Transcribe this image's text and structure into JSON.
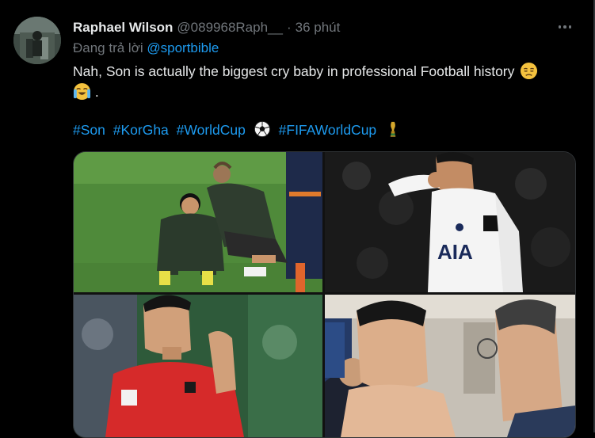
{
  "tweet": {
    "author_name": "Raphael Wilson",
    "author_handle": "@089968Raph__",
    "separator": "·",
    "time": "36 phút",
    "replying_prefix": "Đang trả lời",
    "replying_to": "@sportbible",
    "text": "Nah, Son is actually the biggest cry baby in professional Football history",
    "text_suffix": ".",
    "emojis": [
      "disappointed-face-emoji",
      "crying-face-emoji"
    ],
    "hashtags": [
      "#Son",
      "#KorGha",
      "#WorldCup",
      "#FIFAWorldCup"
    ],
    "hashtag_icons": [
      "soccer-ball-icon",
      "trophy-icon"
    ]
  },
  "media": {
    "photos": [
      "players-sitting-on-pitch",
      "player-wiping-eye-white-kit",
      "player-crying-red-kit",
      "player-crying-locker-room"
    ]
  },
  "colors": {
    "background": "#000000",
    "text": "#e7e9ea",
    "secondary": "#71767b",
    "link": "#1d9bf0",
    "border": "#2f3336"
  }
}
